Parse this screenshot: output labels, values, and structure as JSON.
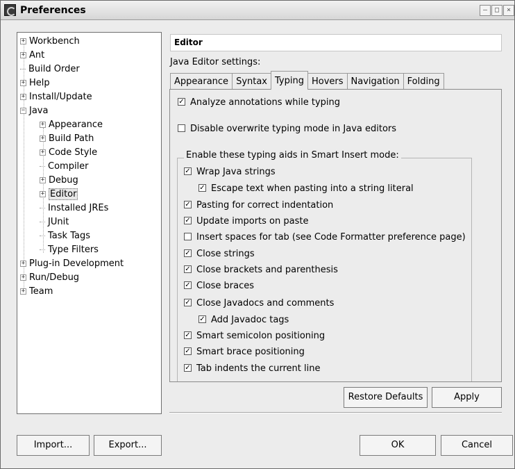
{
  "window": {
    "title": "Preferences"
  },
  "tree": {
    "items": [
      {
        "label": "Workbench",
        "expander": "+"
      },
      {
        "label": "Ant",
        "expander": "+"
      },
      {
        "label": "Build Order",
        "expander": ""
      },
      {
        "label": "Help",
        "expander": "+"
      },
      {
        "label": "Install/Update",
        "expander": "+"
      },
      {
        "label": "Java",
        "expander": "−"
      },
      {
        "label": "Appearance",
        "expander": "+"
      },
      {
        "label": "Build Path",
        "expander": "+"
      },
      {
        "label": "Code Style",
        "expander": "+"
      },
      {
        "label": "Compiler",
        "expander": ""
      },
      {
        "label": "Debug",
        "expander": "+"
      },
      {
        "label": "Editor",
        "expander": "+"
      },
      {
        "label": "Installed JREs",
        "expander": ""
      },
      {
        "label": "JUnit",
        "expander": ""
      },
      {
        "label": "Task Tags",
        "expander": ""
      },
      {
        "label": "Type Filters",
        "expander": ""
      },
      {
        "label": "Plug-in Development",
        "expander": "+"
      },
      {
        "label": "Run/Debug",
        "expander": "+"
      },
      {
        "label": "Team",
        "expander": "+"
      }
    ]
  },
  "page": {
    "title": "Editor",
    "settings_label": "Java Editor settings:",
    "tabs": [
      "Appearance",
      "Syntax",
      "Typing",
      "Hovers",
      "Navigation",
      "Folding"
    ],
    "active_tab": "Typing"
  },
  "typing": {
    "analyze": {
      "label": "Analyze annotations while typing",
      "checked": true
    },
    "disable_overwrite": {
      "label": "Disable overwrite typing mode in Java editors",
      "checked": false
    },
    "group_label": "Enable these typing aids in Smart Insert mode:",
    "options": [
      {
        "label": "Wrap Java strings",
        "checked": true
      },
      {
        "label": "Escape text when pasting into a string literal",
        "checked": true
      },
      {
        "label": "Pasting for correct indentation",
        "checked": true
      },
      {
        "label": "Update imports on paste",
        "checked": true
      },
      {
        "label": "Insert spaces for tab (see Code Formatter preference page)",
        "checked": false
      },
      {
        "label": "Close strings",
        "checked": true
      },
      {
        "label": "Close brackets and parenthesis",
        "checked": true
      },
      {
        "label": "Close braces",
        "checked": true
      },
      {
        "label": "Close Javadocs and comments",
        "checked": true
      },
      {
        "label": "Add Javadoc tags",
        "checked": true
      },
      {
        "label": "Smart semicolon positioning",
        "checked": true
      },
      {
        "label": "Smart brace positioning",
        "checked": true
      },
      {
        "label": "Tab indents the current line",
        "checked": true
      }
    ]
  },
  "buttons": {
    "restore_defaults": "Restore Defaults",
    "apply": "Apply",
    "import": "Import...",
    "export": "Export...",
    "ok": "OK",
    "cancel": "Cancel"
  }
}
